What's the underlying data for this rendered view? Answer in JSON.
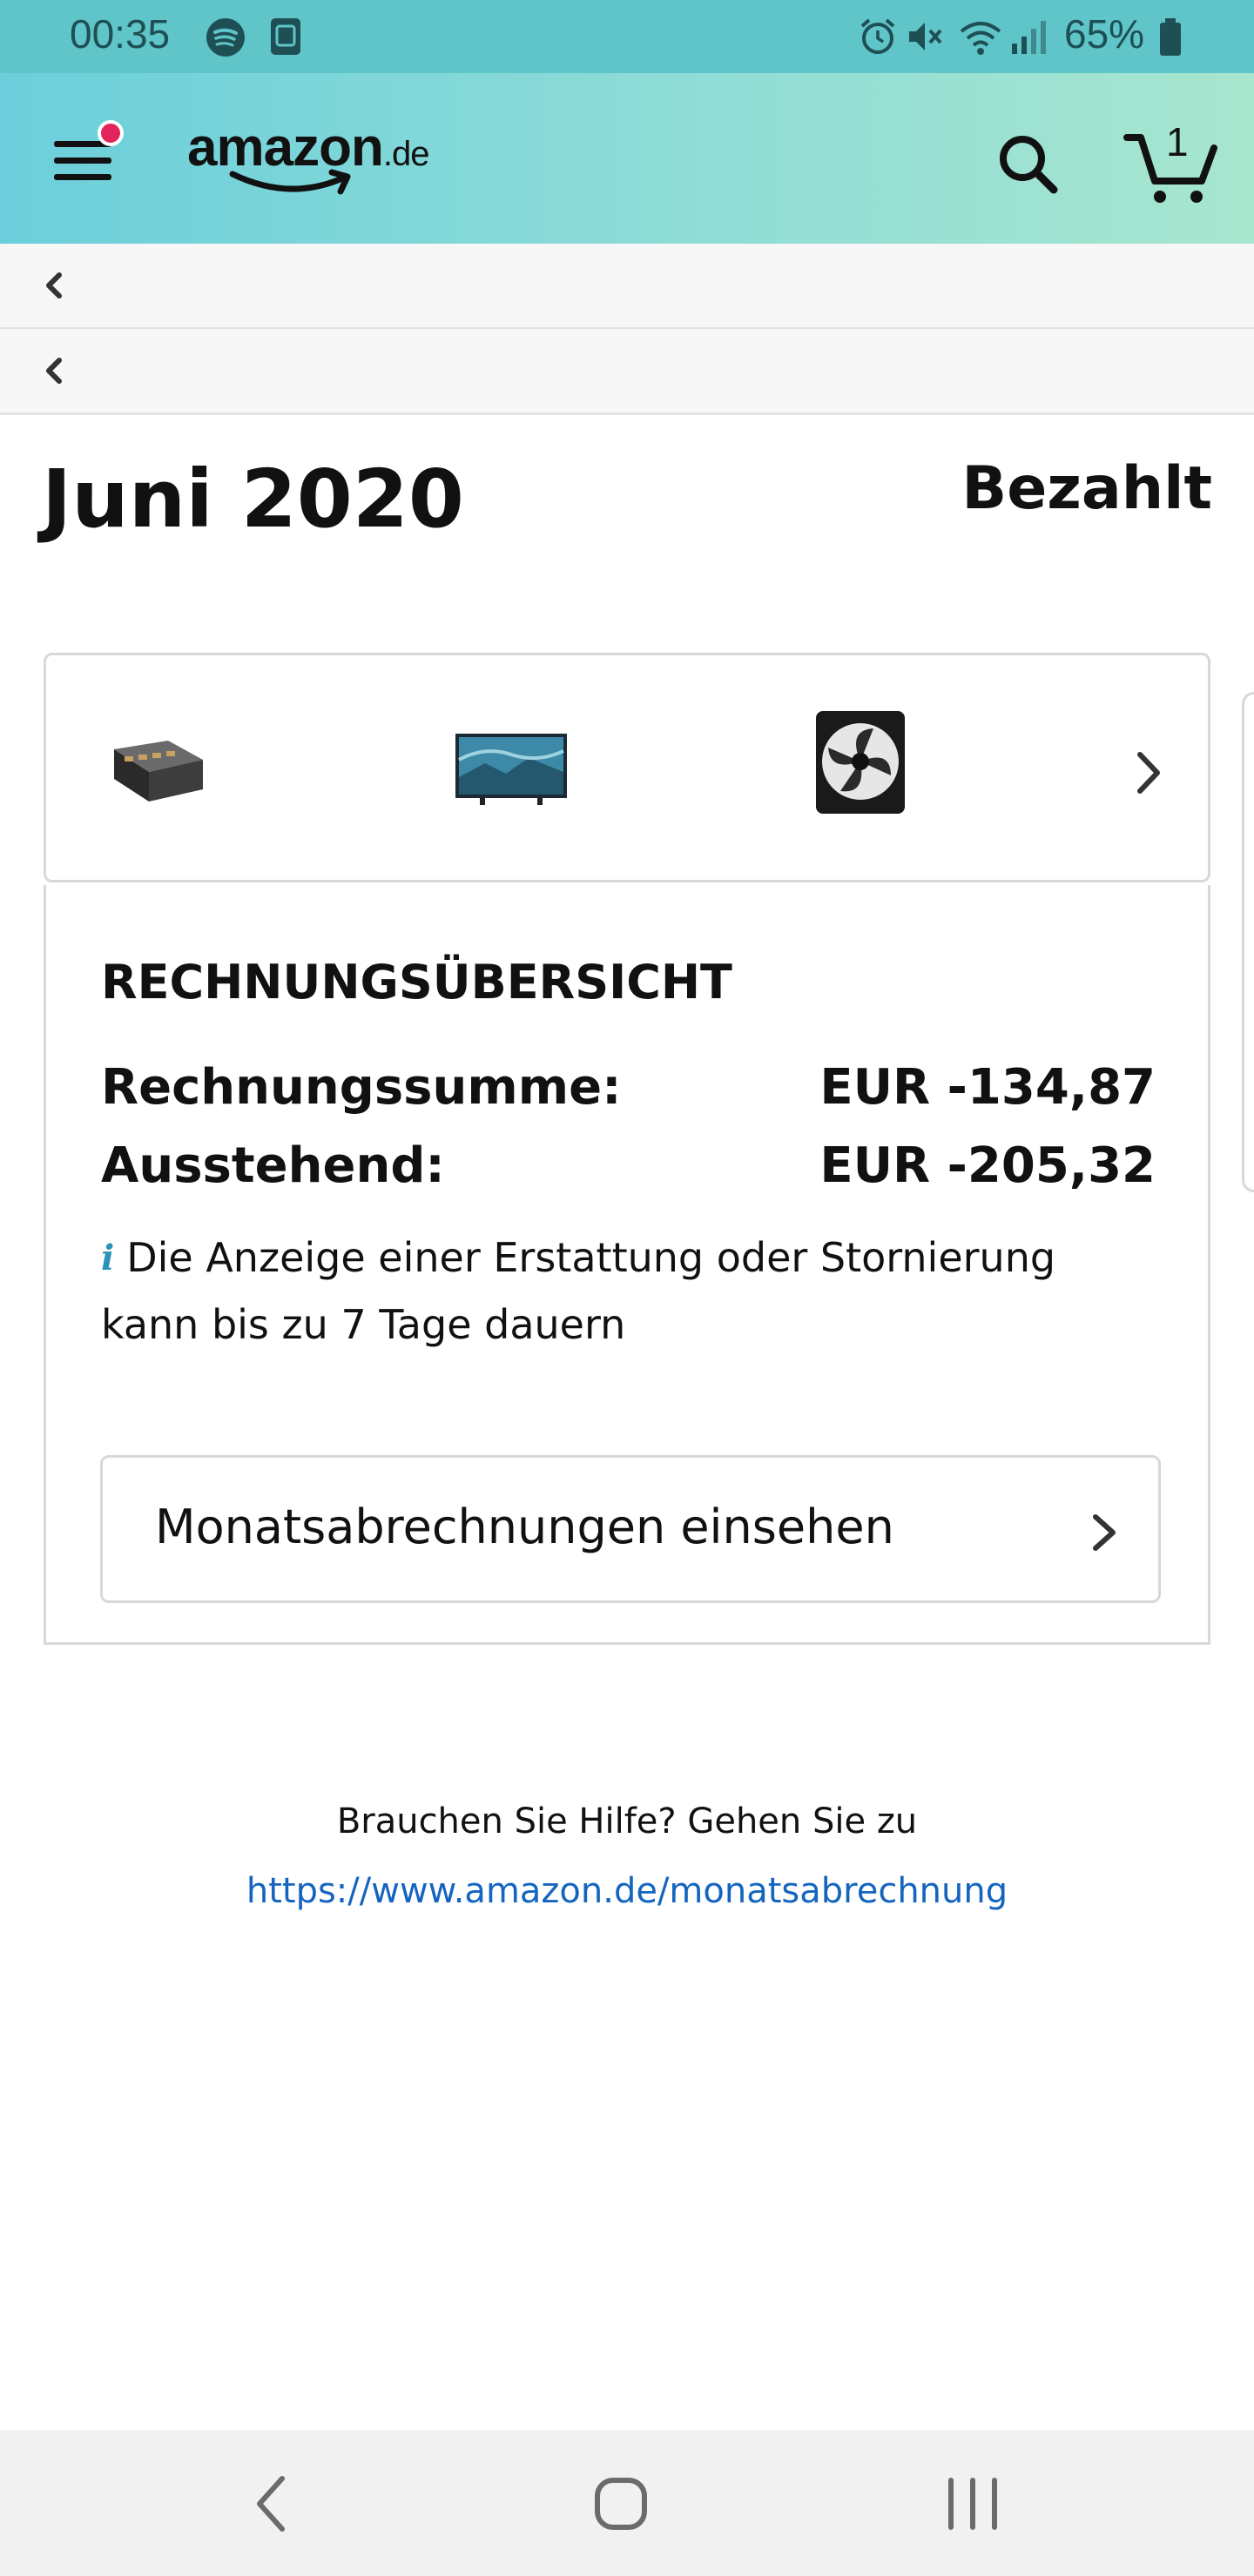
{
  "status_bar": {
    "time": "00:35",
    "battery_percent": "65%",
    "left_icons": [
      "spotify-icon",
      "screenshot-notification-icon"
    ],
    "right_icons": [
      "alarm-icon",
      "mute-icon",
      "wifi-icon",
      "signal-icon",
      "battery-icon"
    ]
  },
  "header": {
    "logo_text": "amazon",
    "logo_tld": ".de",
    "cart_count": "1",
    "menu_has_notification": true,
    "colors": {
      "gradient_start": "#6bcfdb",
      "gradient_end": "#a7e6cf",
      "notification_dot": "#e3245a"
    }
  },
  "breadcrumbs": [
    {
      "icon": "chevron-left-icon"
    },
    {
      "icon": "chevron-left-icon"
    }
  ],
  "statement": {
    "month_title": "Juni 2020",
    "status": "Bezahlt"
  },
  "product_thumbnails": [
    {
      "name": "product-box-thumbnail"
    },
    {
      "name": "tv-thumbnail"
    },
    {
      "name": "cpu-cooler-thumbnail"
    }
  ],
  "summary": {
    "heading": "RECHNUNGSÜBERSICHT",
    "rows": [
      {
        "label": "Rechnungssumme:",
        "value": "EUR -134,87"
      },
      {
        "label": "Ausstehend:",
        "value": "EUR -205,32"
      }
    ],
    "info_icon": "i",
    "info_text": "Die Anzeige einer Erstattung oder Stornierung kann bis zu 7 Tage dauern",
    "monthly_button_label": "Monatsabrechnungen einsehen"
  },
  "help": {
    "text": "Brauchen Sie Hilfe? Gehen Sie zu",
    "link": "https://www.amazon.de/monatsabrechnung",
    "link_color": "#1565c0"
  },
  "nav_bar": {
    "buttons": [
      "back-nav-icon",
      "home-nav-icon",
      "recents-nav-icon"
    ]
  }
}
